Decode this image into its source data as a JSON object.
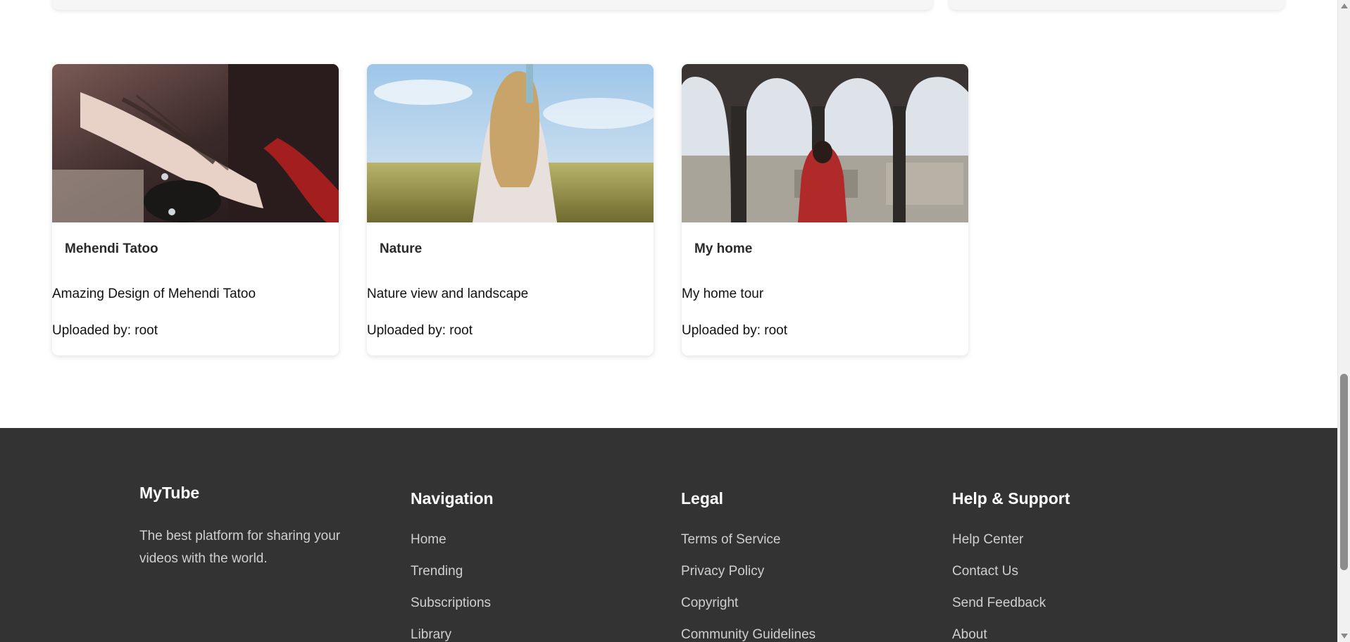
{
  "videos": [
    {
      "title": "Mehendi Tatoo",
      "description": "Amazing Design of Mehendi Tatoo",
      "uploader": "Uploaded by: root"
    },
    {
      "title": "Nature",
      "description": "Nature view and landscape",
      "uploader": "Uploaded by: root"
    },
    {
      "title": "My home",
      "description": "My home tour",
      "uploader": "Uploaded by: root"
    }
  ],
  "footer": {
    "brand": {
      "name": "MyTube",
      "tagline": "The best platform for sharing your videos with the world."
    },
    "navigation": {
      "heading": "Navigation",
      "links": [
        "Home",
        "Trending",
        "Subscriptions",
        "Library"
      ]
    },
    "legal": {
      "heading": "Legal",
      "links": [
        "Terms of Service",
        "Privacy Policy",
        "Copyright",
        "Community Guidelines"
      ]
    },
    "help": {
      "heading": "Help & Support",
      "links": [
        "Help Center",
        "Contact Us",
        "Send Feedback",
        "About"
      ]
    }
  },
  "colors": {
    "footer_bg": "#333333",
    "footer_heading": "#ffffff",
    "footer_link": "#cfcfcf",
    "card_bg": "#ffffff"
  }
}
